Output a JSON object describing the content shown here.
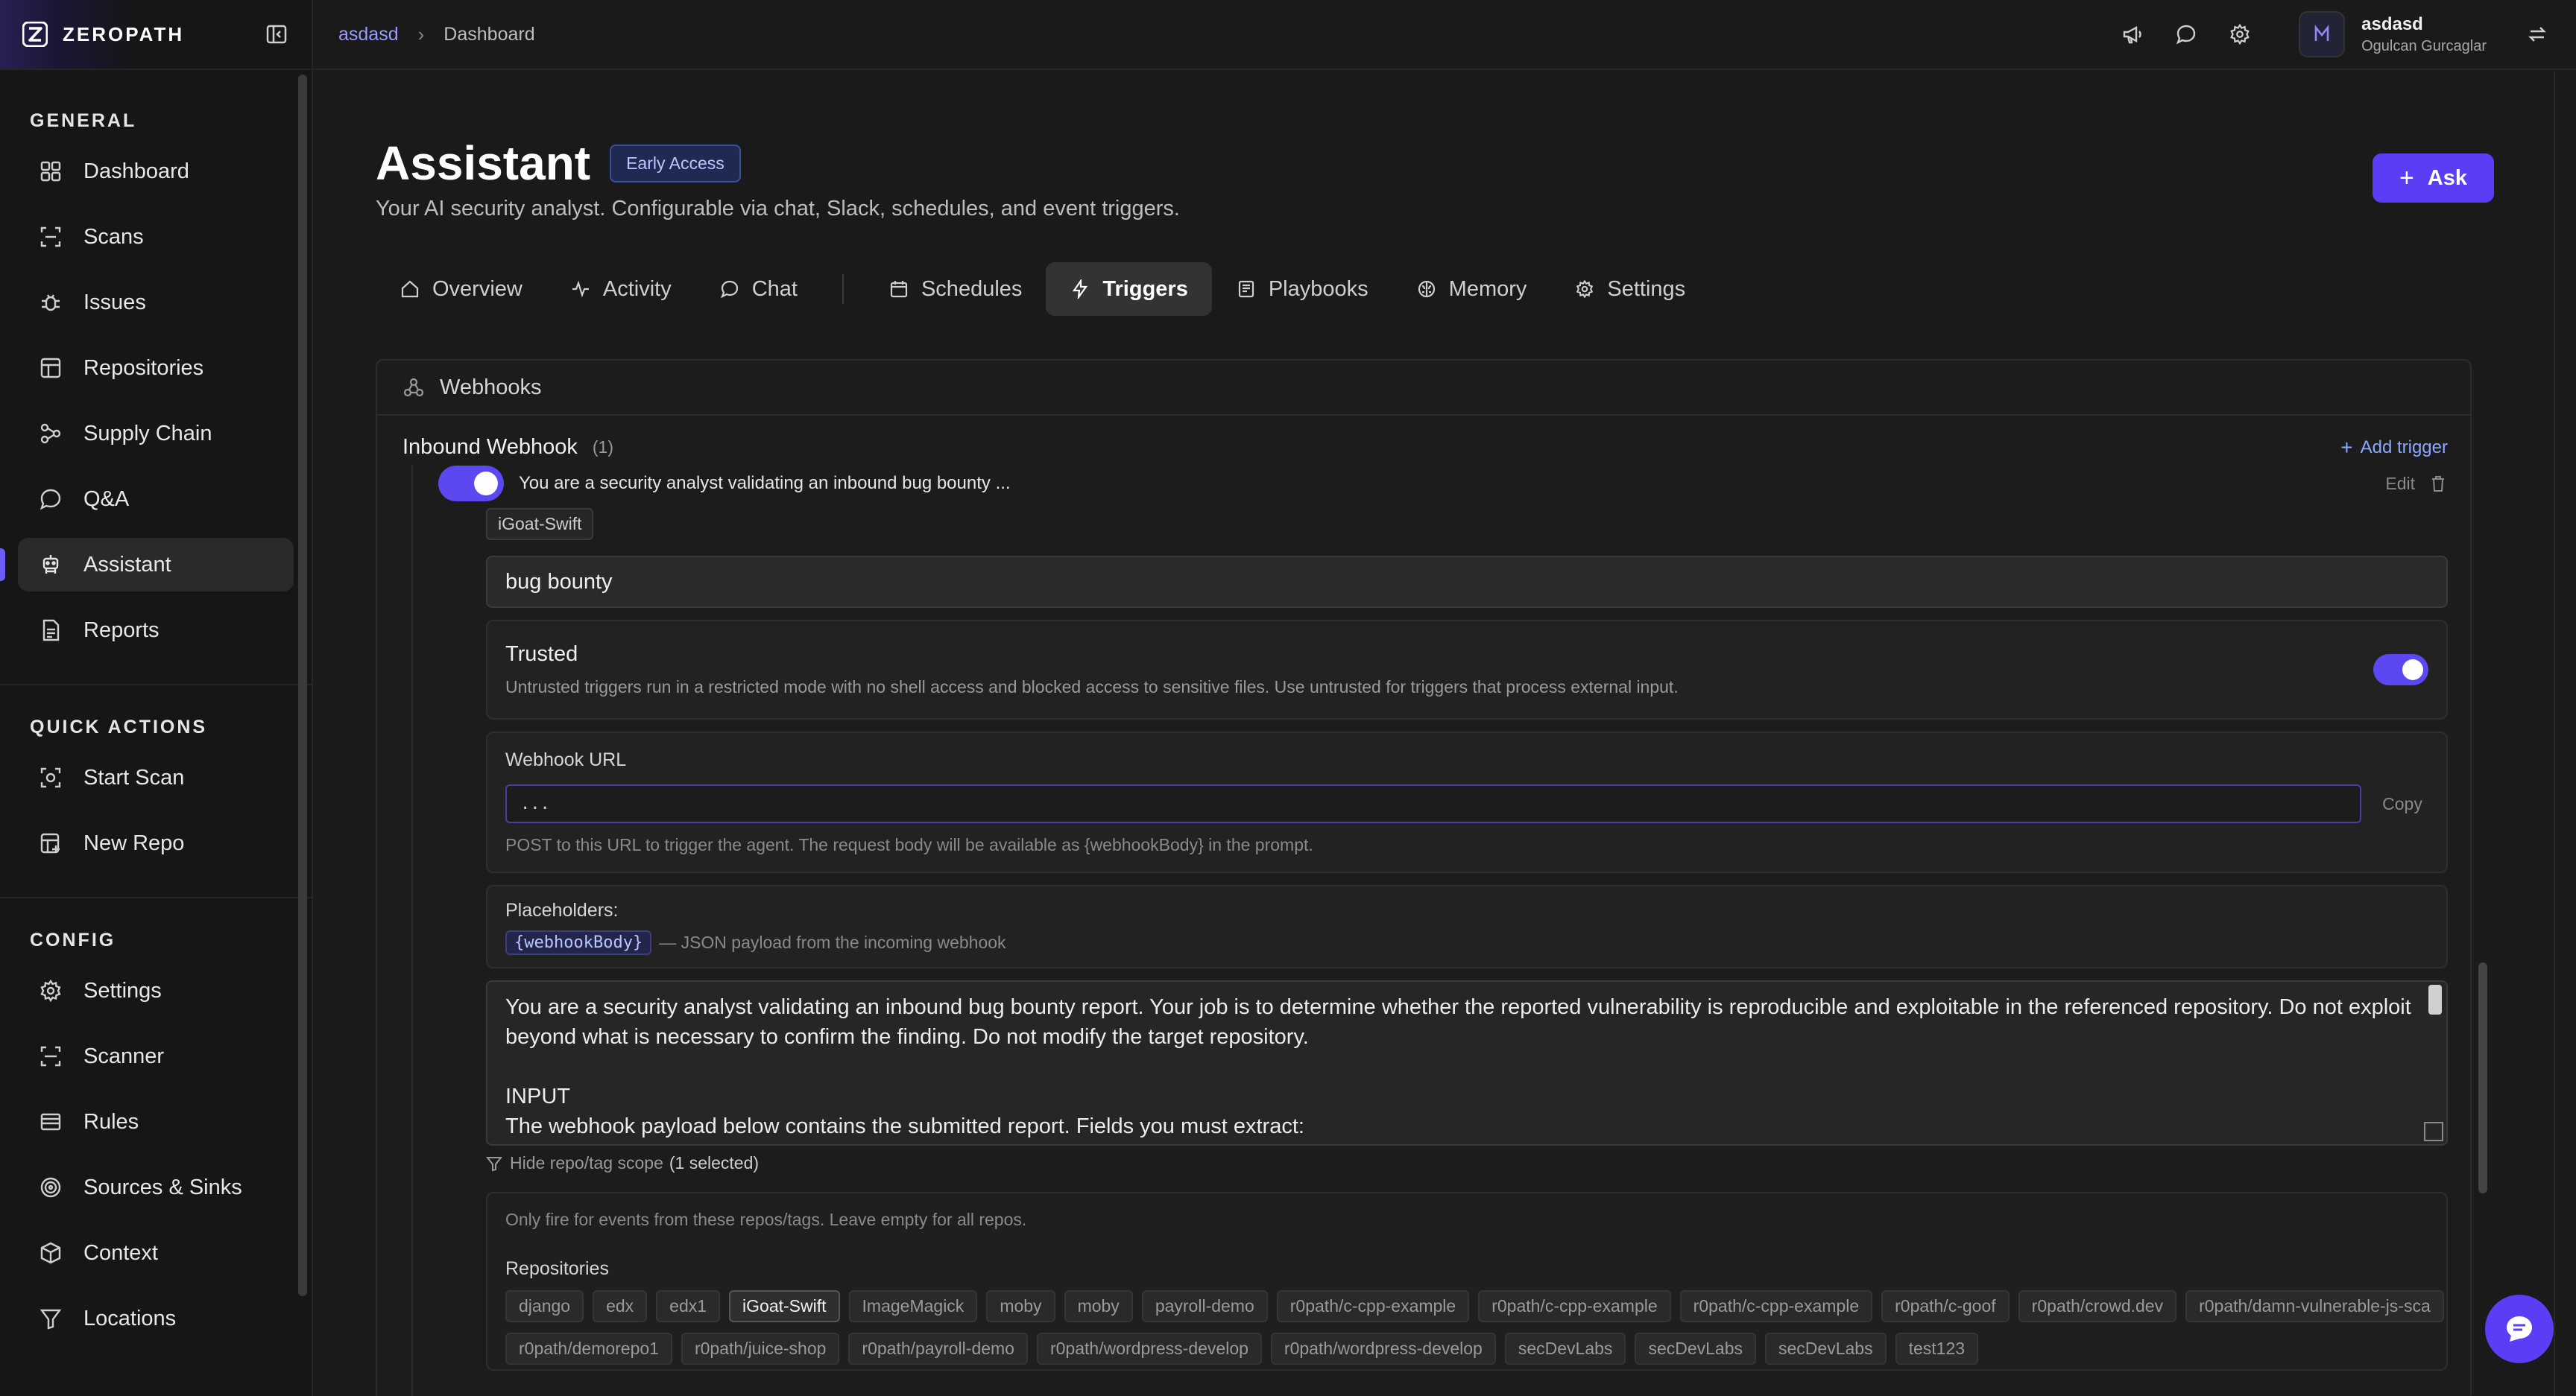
{
  "brand": {
    "name": "ZEROPATH"
  },
  "sidebar": {
    "sections": [
      {
        "title": "GENERAL",
        "items": [
          {
            "label": "Dashboard",
            "icon": "dashboard-icon"
          },
          {
            "label": "Scans",
            "icon": "scan-icon"
          },
          {
            "label": "Issues",
            "icon": "bug-icon"
          },
          {
            "label": "Repositories",
            "icon": "table-icon"
          },
          {
            "label": "Supply Chain",
            "icon": "network-icon"
          },
          {
            "label": "Q&A",
            "icon": "chat-icon"
          },
          {
            "label": "Assistant",
            "icon": "robot-icon",
            "active": true
          },
          {
            "label": "Reports",
            "icon": "report-icon"
          }
        ]
      },
      {
        "title": "QUICK ACTIONS",
        "items": [
          {
            "label": "Start Scan",
            "icon": "start-scan-icon"
          },
          {
            "label": "New Repo",
            "icon": "new-repo-icon"
          }
        ]
      },
      {
        "title": "CONFIG",
        "items": [
          {
            "label": "Settings",
            "icon": "gear-icon"
          },
          {
            "label": "Scanner",
            "icon": "scanner-icon"
          },
          {
            "label": "Rules",
            "icon": "rules-icon"
          },
          {
            "label": "Sources & Sinks",
            "icon": "target-icon"
          },
          {
            "label": "Context",
            "icon": "box-icon"
          },
          {
            "label": "Locations",
            "icon": "filter-icon"
          }
        ]
      }
    ]
  },
  "topbar": {
    "breadcrumb": {
      "org": "asdasd",
      "separator": "›",
      "current": "Dashboard"
    },
    "icons": [
      "megaphone-icon",
      "comment-icon",
      "gear-icon"
    ],
    "user": {
      "name": "asdasd",
      "subtitle": "Ogulcan Gurcaglar"
    }
  },
  "page": {
    "title": "Assistant",
    "badge": "Early Access",
    "subtitle": "Your AI security analyst. Configurable via chat, Slack, schedules, and event triggers.",
    "ask_button": "Ask"
  },
  "tabs": [
    {
      "label": "Overview",
      "icon": "home-icon"
    },
    {
      "label": "Activity",
      "icon": "activity-icon"
    },
    {
      "label": "Chat",
      "icon": "chat-icon"
    },
    {
      "label": "Schedules",
      "icon": "calendar-icon"
    },
    {
      "label": "Triggers",
      "icon": "bolt-icon",
      "active": true
    },
    {
      "label": "Playbooks",
      "icon": "book-icon"
    },
    {
      "label": "Memory",
      "icon": "brain-icon"
    },
    {
      "label": "Settings",
      "icon": "gear-icon"
    }
  ],
  "webhooks": {
    "header": "Webhooks",
    "inbound_title": "Inbound Webhook",
    "inbound_count": "(1)",
    "add_trigger": "Add trigger",
    "trigger": {
      "enabled": true,
      "summary": "You are a security analyst validating an inbound bug bounty ...",
      "edit": "Edit",
      "repo_chip": "iGoat-Swift",
      "name_value": "bug bounty",
      "trusted_title": "Trusted",
      "trusted_desc": "Untrusted triggers run in a restricted mode with no shell access and blocked access to sensitive files. Use untrusted for triggers that process external input.",
      "trusted_enabled": true,
      "webhook_url_label": "Webhook URL",
      "webhook_url_value": "...",
      "copy": "Copy",
      "url_help": "POST to this URL to trigger the agent. The request body will be available as {webhookBody} in the prompt.",
      "placeholders_label": "Placeholders:",
      "placeholder_chip": "{webhookBody}",
      "placeholder_desc": "— JSON payload from the incoming webhook",
      "prompt": "You are a security analyst validating an inbound bug bounty report. Your job is to determine whether the reported vulnerability is reproducible and exploitable in the referenced repository. Do not exploit beyond what is necessary to confirm the finding. Do not modify the target repository.\n\nINPUT\nThe webhook payload below contains the submitted report. Fields you must extract:",
      "scope_toggle": "Hide repo/tag scope",
      "scope_selected": "(1 selected)",
      "scope_help": "Only fire for events from these repos/tags. Leave empty for all repos.",
      "repos_label": "Repositories",
      "repos": [
        "django",
        "edx",
        "edx1",
        "iGoat-Swift",
        "ImageMagick",
        "moby",
        "moby",
        "payroll-demo",
        "r0path/c-cpp-example",
        "r0path/c-cpp-example",
        "r0path/c-cpp-example",
        "r0path/c-goof",
        "r0path/crowd.dev",
        "r0path/damn-vulnerable-js-sca",
        "r0path/demorepo1",
        "r0path/juice-shop",
        "r0path/payroll-demo",
        "r0path/wordpress-develop",
        "r0path/wordpress-develop",
        "secDevLabs",
        "secDevLabs",
        "secDevLabs",
        "test123"
      ],
      "selected_repo": "iGoat-Swift"
    }
  },
  "colors": {
    "accent": "#5b3df5",
    "toggle": "#5b48f0",
    "link": "#9a9aff"
  }
}
